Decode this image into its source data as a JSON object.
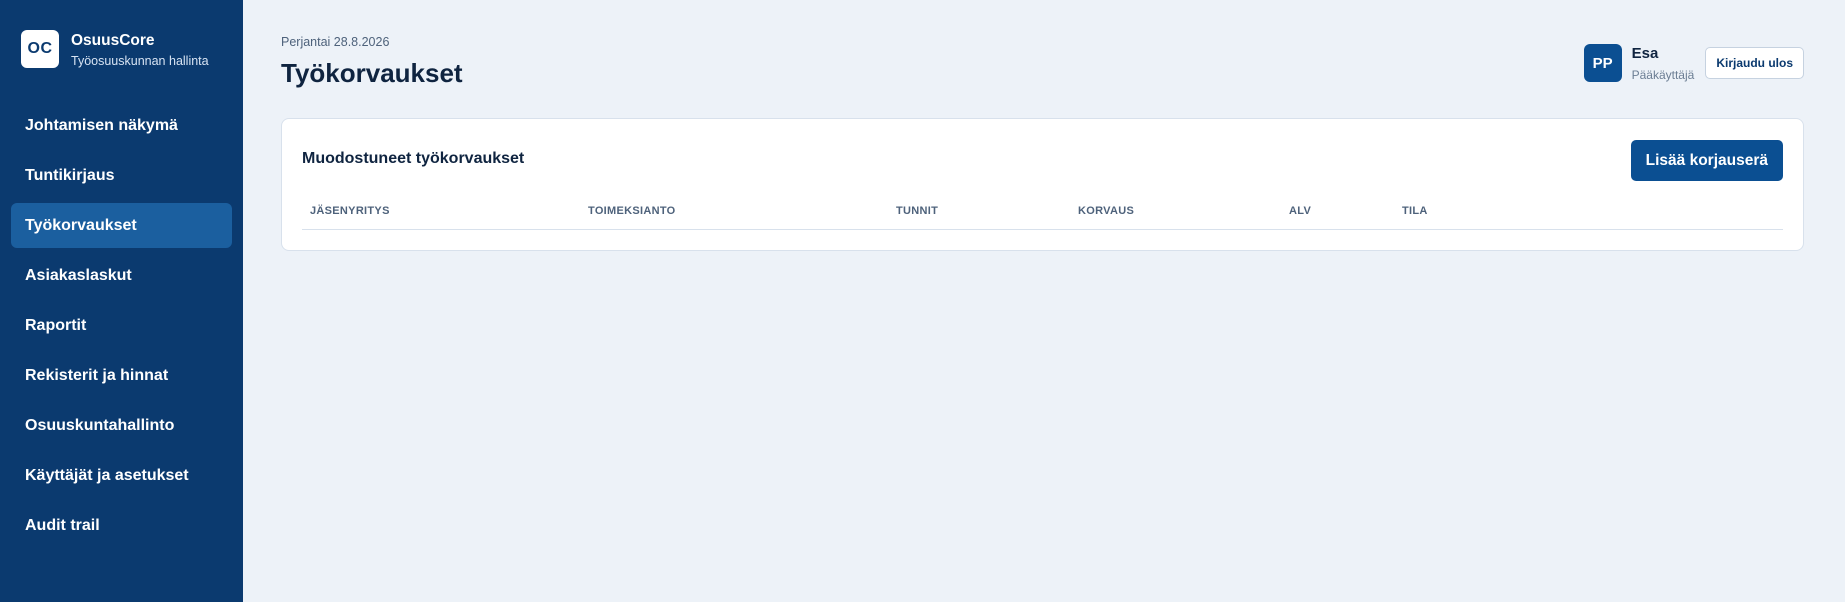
{
  "brand": {
    "logo_text": "OC",
    "name": "OsuusCore",
    "subtitle": "Työosuuskunnan hallinta"
  },
  "sidebar": {
    "items": [
      {
        "label": "Johtamisen näkymä",
        "active": false
      },
      {
        "label": "Tuntikirjaus",
        "active": false
      },
      {
        "label": "Työkorvaukset",
        "active": true
      },
      {
        "label": "Asiakaslaskut",
        "active": false
      },
      {
        "label": "Raportit",
        "active": false
      },
      {
        "label": "Rekisterit ja hinnat",
        "active": false
      },
      {
        "label": "Osuuskuntahallinto",
        "active": false
      },
      {
        "label": "Käyttäjät ja asetukset",
        "active": false
      },
      {
        "label": "Audit trail",
        "active": false
      }
    ]
  },
  "header": {
    "date": "Perjantai 28.8.2026",
    "title": "Työkorvaukset"
  },
  "user": {
    "initials": "PP",
    "name": "Esa",
    "role": "Pääkäyttäjä",
    "logout_label": "Kirjaudu ulos"
  },
  "card": {
    "title": "Muodostuneet työkorvaukset",
    "add_button_label": "Lisää korjauserä",
    "columns": [
      "JÄSENYRITYS",
      "TOIMEKSIANTO",
      "TUNNIT",
      "KORVAUS",
      "ALV",
      "TILA"
    ],
    "rows": []
  },
  "colors": {
    "sidebar_bg": "#0b3a6f",
    "sidebar_active": "#1b5f9f",
    "primary": "#0b4f92",
    "page_bg": "#edf2f8"
  }
}
